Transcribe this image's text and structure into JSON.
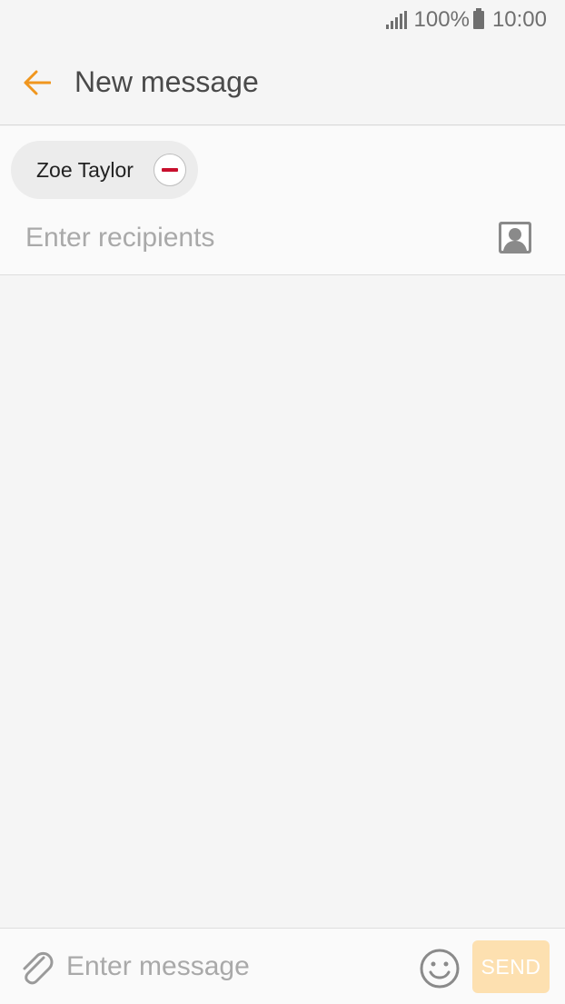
{
  "status_bar": {
    "signal_icon": "signal-bars-icon",
    "battery_percent": "100%",
    "battery_icon": "battery-icon",
    "time": "10:00"
  },
  "app_bar": {
    "back_icon": "arrow-back-icon",
    "title": "New message"
  },
  "recipients": {
    "chips": [
      {
        "label": "Zoe Taylor",
        "remove_icon": "minus-circle-icon"
      }
    ],
    "input_placeholder": "Enter recipients",
    "contacts_icon": "contact-card-icon"
  },
  "composer": {
    "attach_icon": "paperclip-icon",
    "message_placeholder": "Enter message",
    "emoji_icon": "smiley-icon",
    "send_label": "SEND"
  },
  "colors": {
    "accent": "#f0961e",
    "remove_red": "#c8102e",
    "send_disabled_bg": "#fde0b0"
  }
}
